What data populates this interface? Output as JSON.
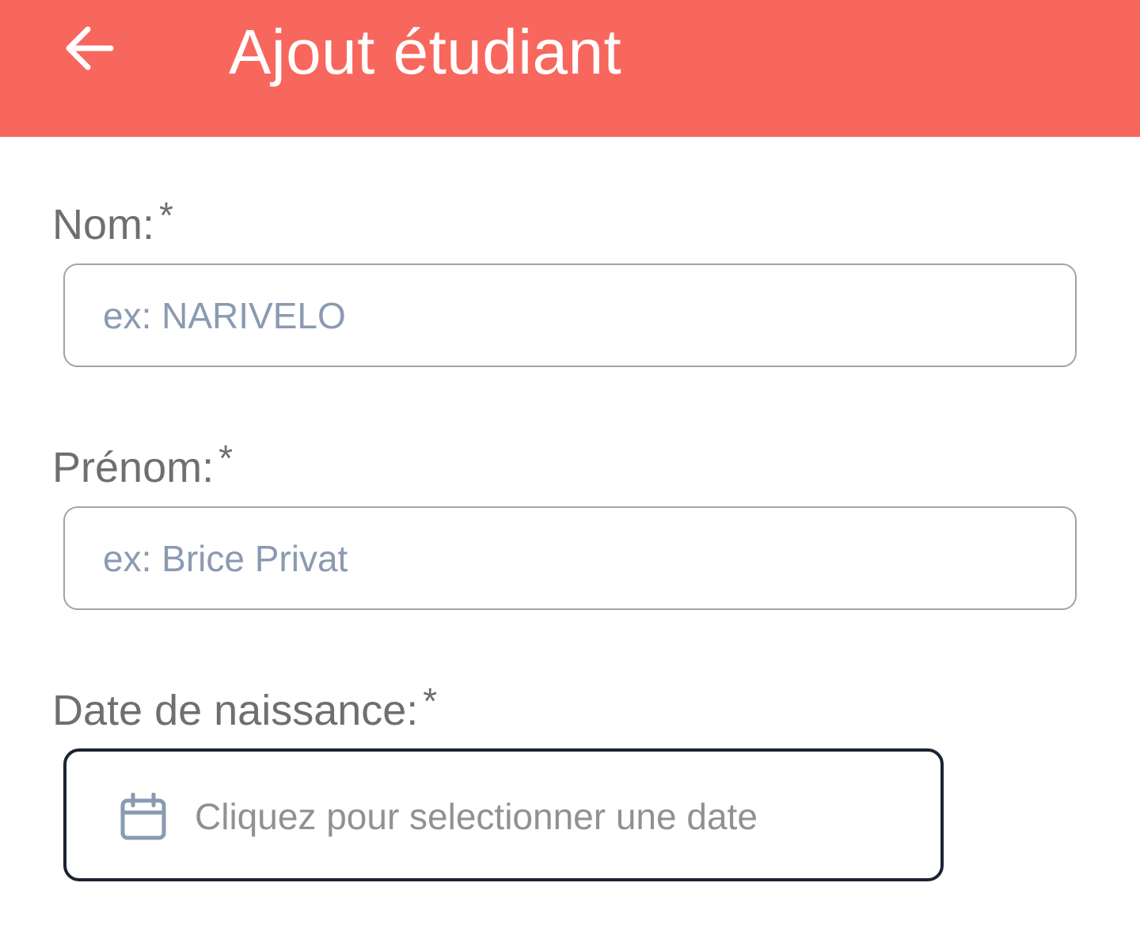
{
  "header": {
    "title": "Ajout étudiant",
    "back_icon": "arrow-left-icon",
    "background_color": "#f8675d"
  },
  "form": {
    "nom": {
      "label": "Nom:",
      "required_mark": "*",
      "placeholder": "ex: NARIVELO",
      "value": ""
    },
    "prenom": {
      "label": "Prénom:",
      "required_mark": "*",
      "placeholder": "ex: Brice Privat",
      "value": ""
    },
    "date_naissance": {
      "label": "Date de naissance:",
      "required_mark": "*",
      "placeholder": "Cliquez pour selectionner une date",
      "icon": "calendar-icon"
    }
  }
}
